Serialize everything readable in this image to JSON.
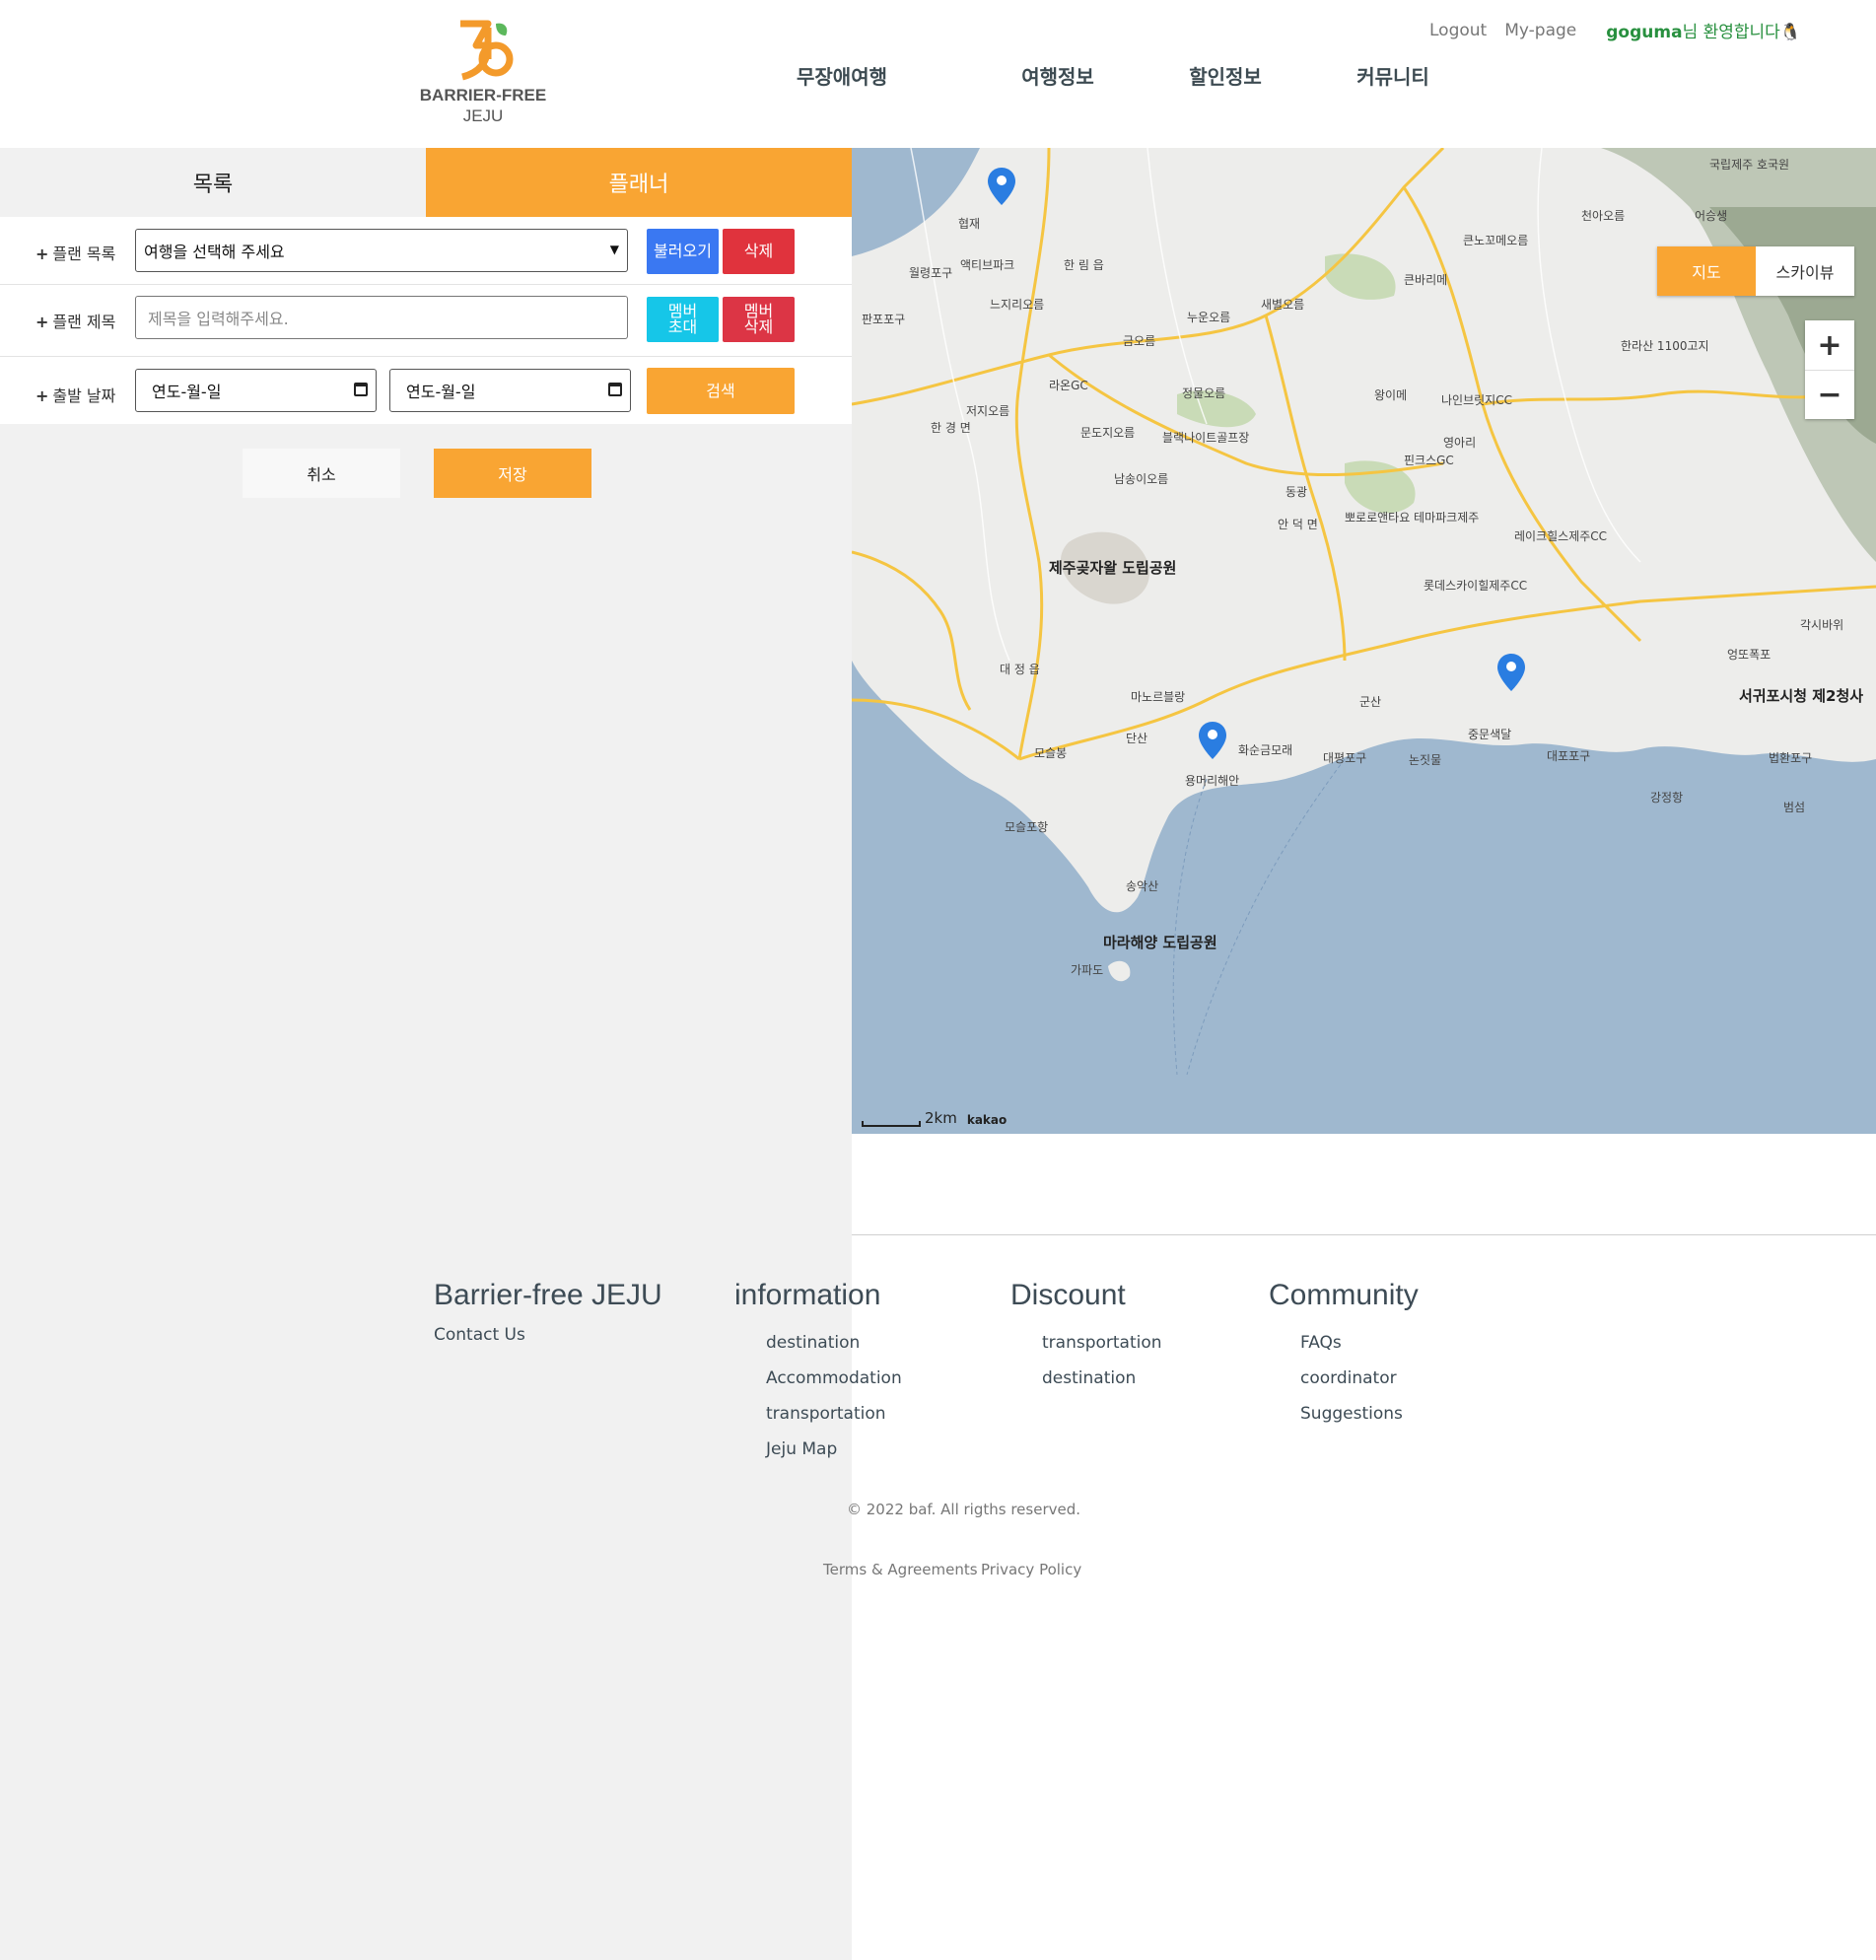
{
  "header": {
    "logo_text_line1": "BARRIER-FREE",
    "logo_text_line2": "JEJU",
    "logout": "Logout",
    "mypage": "My-page",
    "username": "goguma",
    "greeting": "님 환영합니다",
    "nav": [
      "무장애여행",
      "여행정보",
      "할인정보",
      "커뮤니티"
    ]
  },
  "tabs": {
    "list": "목록",
    "planner": "플래너"
  },
  "form": {
    "plan_list_label": "플랜 목록",
    "plan_select_value": "여행을 선택해 주세요",
    "load_button": "불러오기",
    "delete_button": "삭제",
    "plan_title_label": "플랜 제목",
    "plan_title_placeholder": "제목을 입력해주세요.",
    "member_invite_line1": "멤버",
    "member_invite_line2": "초대",
    "member_delete_line1": "멤버",
    "member_delete_line2": "삭제",
    "date_label": "출발 날짜",
    "start_date": "연도-월-일",
    "end_date": "연도-월-일",
    "search_button": "검색",
    "cancel_button": "취소",
    "save_button": "저장"
  },
  "map": {
    "toggle_map": "지도",
    "toggle_skyview": "스카이뷰",
    "zoom_in": "+",
    "zoom_out": "−",
    "scale": "2km",
    "provider": "kakao",
    "places": {
      "p1": "협재",
      "p2": "월령포구",
      "p3": "판포포구",
      "p4": "액티브파크",
      "p5": "한 림 읍",
      "p6": "느지리오름",
      "p7": "금오름",
      "p8": "누운오름",
      "p9": "새별오름",
      "p10": "라온GC",
      "p11": "저지오름",
      "p12": "한 경 면",
      "p13": "정물오름",
      "p14": "문도지오름",
      "p15": "블랙나이트골프장",
      "p16": "남송이오름",
      "p17": "동광",
      "p18": "제주곶자왈 도립공원",
      "p19": "안 덕 면",
      "p20": "뽀로로앤타요 테마파크제주",
      "p21": "핀크스GC",
      "p22": "롯데스카이힐제주CC",
      "p23": "레이크힐스제주CC",
      "p24": "대 정 읍",
      "p25": "마노르블랑",
      "p26": "단산",
      "p27": "모슬봉",
      "p28": "모슬포항",
      "p29": "용머리해안",
      "p30": "화순금모래",
      "p31": "대평포구",
      "p32": "논짓물",
      "p33": "중문색달",
      "p34": "대포포구",
      "p35": "군산",
      "p36": "송악산",
      "p37": "마라해양 도립공원",
      "p38": "가파도",
      "p39": "강정항",
      "p40": "법환포구",
      "p41": "범섬",
      "p42": "서귀포시청 제2청사",
      "p43": "엉또폭포",
      "p44": "각시바위",
      "p45": "한라산 1100고지",
      "p46": "큰노꼬메오름",
      "p47": "큰바리메",
      "p48": "왕이메",
      "p49": "나인브릿지CC",
      "p50": "영아리",
      "p51": "천아오름",
      "p52": "어승생",
      "p53": "국립제주 호국원"
    }
  },
  "footer": {
    "brand": "Barrier-free JEJU",
    "contact": "Contact Us",
    "information_title": "information",
    "information_links": [
      "destination",
      "Accommodation",
      "transportation",
      "Jeju Map"
    ],
    "discount_title": "Discount",
    "discount_links": [
      "transportation",
      "destination"
    ],
    "community_title": "Community",
    "community_links": [
      "FAQs",
      "coordinator",
      "Suggestions"
    ],
    "copyright": "© 2022 baf. All rigths reserved.",
    "terms": "Terms & Agreements",
    "privacy": "Privacy Policy"
  },
  "colors": {
    "accent": "#f9a533",
    "blue": "#3a78f2",
    "red": "#e0333d",
    "cyan": "#16c6e8",
    "sea": "#9fb8cf",
    "land": "#ededeb"
  }
}
